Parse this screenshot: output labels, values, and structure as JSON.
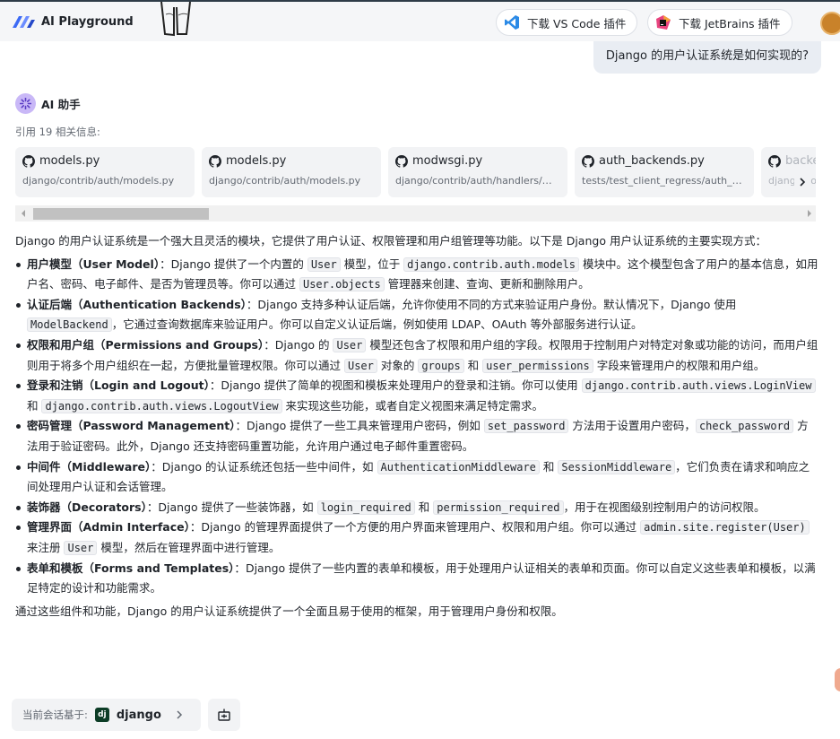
{
  "app": {
    "title": "AI Playground"
  },
  "toolbar": {
    "vscode_label": "下载 VS Code 插件",
    "jetbrains_label": "下载 JetBrains 插件"
  },
  "conversation": {
    "question": "Django 的用户认证系统是如何实现的?",
    "assistant_name": "AI 助手",
    "citation_count": "引用 19 相关信息:"
  },
  "citations": [
    {
      "title": "models.py",
      "path": "django/contrib/auth/models.py"
    },
    {
      "title": "models.py",
      "path": "django/contrib/auth/models.py"
    },
    {
      "title": "modwsgi.py",
      "path": "django/contrib/auth/handlers/modwsgi.py"
    },
    {
      "title": "auth_backends.py",
      "path": "tests/test_client_regress/auth_backends.py"
    },
    {
      "title": "backends.py",
      "path": "django/contrib/auth/backends.py"
    }
  ],
  "answer": {
    "intro": "Django 的用户认证系统是一个强大且灵活的模块，它提供了用户认证、权限管理和用户组管理等功能。以下是 Django 用户认证系统的主要实现方式：",
    "items": [
      {
        "title": "用户模型（User Model）",
        "sep": "：",
        "segments": [
          {
            "t": "Django 提供了一个内置的 "
          },
          {
            "c": "User"
          },
          {
            "t": " 模型，位于 "
          },
          {
            "c": "django.contrib.auth.models"
          },
          {
            "t": " 模块中。这个模型包含了用户的基本信息，如用户名、密码、电子邮件、是否为管理员等。你可以通过 "
          },
          {
            "c": "User.objects"
          },
          {
            "t": " 管理器来创建、查询、更新和删除用户。"
          }
        ]
      },
      {
        "title": "认证后端（Authentication Backends）",
        "sep": "：",
        "segments": [
          {
            "t": "Django 支持多种认证后端，允许你使用不同的方式来验证用户身份。默认情况下，Django 使用 "
          },
          {
            "c": "ModelBackend"
          },
          {
            "t": "，它通过查询数据库来验证用户。你可以自定义认证后端，例如使用 LDAP、OAuth 等外部服务进行认证。"
          }
        ]
      },
      {
        "title": "权限和用户组（Permissions and Groups）",
        "sep": "：",
        "segments": [
          {
            "t": "Django 的 "
          },
          {
            "c": "User"
          },
          {
            "t": " 模型还包含了权限和用户组的字段。权限用于控制用户对特定对象或功能的访问，而用户组则用于将多个用户组织在一起，方便批量管理权限。你可以通过 "
          },
          {
            "c": "User"
          },
          {
            "t": " 对象的 "
          },
          {
            "c": "groups"
          },
          {
            "t": " 和 "
          },
          {
            "c": "user_permissions"
          },
          {
            "t": " 字段来管理用户的权限和用户组。"
          }
        ]
      },
      {
        "title": "登录和注销（Login and Logout）",
        "sep": "：",
        "segments": [
          {
            "t": "Django 提供了简单的视图和模板来处理用户的登录和注销。你可以使用 "
          },
          {
            "c": "django.contrib.auth.views.LoginView"
          },
          {
            "t": " 和 "
          },
          {
            "c": "django.contrib.auth.views.LogoutView"
          },
          {
            "t": " 来实现这些功能，或者自定义视图来满足特定需求。"
          }
        ]
      },
      {
        "title": "密码管理（Password Management）",
        "sep": "：",
        "segments": [
          {
            "t": "Django 提供了一些工具来管理用户密码，例如 "
          },
          {
            "c": "set_password"
          },
          {
            "t": " 方法用于设置用户密码，"
          },
          {
            "c": "check_password"
          },
          {
            "t": " 方法用于验证密码。此外，Django 还支持密码重置功能，允许用户通过电子邮件重置密码。"
          }
        ]
      },
      {
        "title": "中间件（Middleware）",
        "sep": "：",
        "segments": [
          {
            "t": "Django 的认证系统还包括一些中间件，如 "
          },
          {
            "c": "AuthenticationMiddleware"
          },
          {
            "t": " 和 "
          },
          {
            "c": "SessionMiddleware"
          },
          {
            "t": "，它们负责在请求和响应之间处理用户认证和会话管理。"
          }
        ]
      },
      {
        "title": "装饰器（Decorators）",
        "sep": "：",
        "segments": [
          {
            "t": "Django 提供了一些装饰器，如 "
          },
          {
            "c": "login_required"
          },
          {
            "t": " 和 "
          },
          {
            "c": "permission_required"
          },
          {
            "t": "，用于在视图级别控制用户的访问权限。"
          }
        ]
      },
      {
        "title": "管理界面（Admin Interface）",
        "sep": "：",
        "segments": [
          {
            "t": "Django 的管理界面提供了一个方便的用户界面来管理用户、权限和用户组。你可以通过 "
          },
          {
            "c": "admin.site.register(User)"
          },
          {
            "t": " 来注册 "
          },
          {
            "c": "User"
          },
          {
            "t": " 模型，然后在管理界面中进行管理。"
          }
        ]
      },
      {
        "title": "表单和模板（Forms and Templates）",
        "sep": "：",
        "segments": [
          {
            "t": "Django 提供了一些内置的表单和模板，用于处理用户认证相关的表单和页面。你可以自定义这些表单和模板，以满足特定的设计和功能需求。"
          }
        ]
      }
    ],
    "outro": "通过这些组件和功能，Django 的用户认证系统提供了一个全面且易于使用的框架，用于管理用户身份和权限。"
  },
  "footer": {
    "context_label": "当前会话基于:",
    "repo_badge": "dj",
    "repo_name": "django"
  },
  "colors": {
    "accent": "#3d6bf5",
    "topbar_bg": "#f5f6f8",
    "code_bg": "#f1f2f4",
    "card_bg": "#f2f3f5"
  },
  "icons": [
    "app-logo-icon",
    "vscode-icon",
    "jetbrains-icon",
    "ai-sparkle-icon",
    "github-icon",
    "chevron-right-icon",
    "context-settings-icon"
  ]
}
